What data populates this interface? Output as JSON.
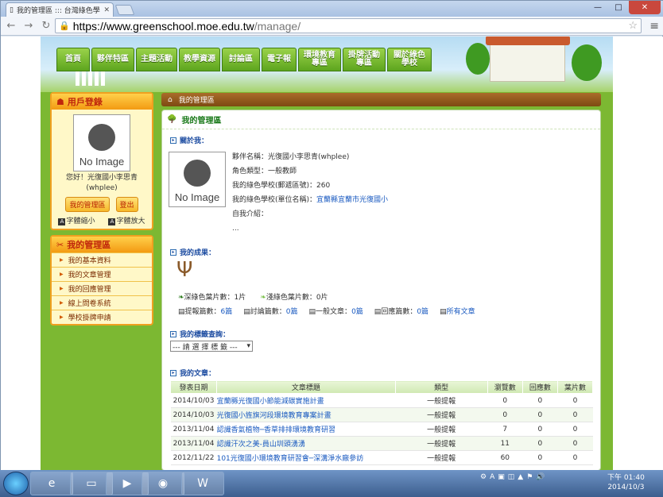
{
  "browser": {
    "tab_title": "我的管理區 ::: 台灣綠色學",
    "url_host": "https://www.greenschool.moe.edu.tw",
    "url_path": "/manage/"
  },
  "nav": {
    "items": [
      "首頁",
      "夥伴特區",
      "主題活動",
      "教學資源",
      "討論區",
      "電子報",
      "環境教育專區",
      "掛牌活動專區",
      "關於綠色學校"
    ]
  },
  "sidebar": {
    "login_title": "用戶登錄",
    "no_image": "No Image",
    "greeting": "您好！光復國小李思青",
    "user_id": "(whplee)",
    "btn_manage": "我的管理區",
    "btn_logout": "登出",
    "font_small": "字體縮小",
    "font_large": "字體放大",
    "menu_title": "我的管理區",
    "menu": [
      "我的基本資料",
      "我的文章管理",
      "我的回應管理",
      "線上問卷系統",
      "學校掛牌申請"
    ]
  },
  "breadcrumb": "我的管理區",
  "main": {
    "title": "我的管理區",
    "about_head": "關於我：",
    "no_image": "No Image",
    "fields": [
      {
        "k": "夥伴名稱：",
        "v": "光復國小李思青(whplee)"
      },
      {
        "k": "角色類型：",
        "v": "一般教師"
      },
      {
        "k": "我的綠色學校(郵遞區號)：",
        "v": "260"
      },
      {
        "k": "我的綠色學校(單位名稱)：",
        "v": "宜蘭縣宜蘭市光復國小"
      },
      {
        "k": "自我介紹：",
        "v": ""
      },
      {
        "k": "",
        "v": "..."
      }
    ],
    "results_head": "我的成果：",
    "deep_leaf": "深綠色葉片數：1片",
    "light_leaf": "淺綠色葉片數：0片",
    "stats": [
      {
        "k": "提報篇數：",
        "v": "6篇"
      },
      {
        "k": "討論篇數：",
        "v": "0篇"
      },
      {
        "k": "一般文章：",
        "v": "0篇"
      },
      {
        "k": "回應篇數：",
        "v": "0篇"
      }
    ],
    "all_articles": "所有文章",
    "tags_head": "我的標籤查詢：",
    "tag_select": "--- 請 選 擇 標 籤 ---",
    "articles_head": "我的文章：",
    "columns": [
      "發表日期",
      "文章標題",
      "類型",
      "瀏覽數",
      "回應數",
      "葉片數"
    ],
    "rows": [
      [
        "2014/10/03",
        "宜蘭縣光復國小節能減碳實施計畫",
        "一般提報",
        "0",
        "0",
        "0"
      ],
      [
        "2014/10/03",
        "光復國小旌旗河段環境教育專案計畫",
        "一般提報",
        "0",
        "0",
        "0"
      ],
      [
        "2013/11/04",
        "認識香氣植物─香草排排環境教育研習",
        "一般提報",
        "7",
        "0",
        "0"
      ],
      [
        "2013/11/04",
        "認識汗次之美-員山圳頭湧湧",
        "一般提報",
        "11",
        "0",
        "0"
      ],
      [
        "2012/11/22",
        "101光復國小環境教育研習會─深溝淨水廠參訪",
        "一般提報",
        "60",
        "0",
        "0"
      ]
    ]
  },
  "taskbar": {
    "time": "下午 01:40",
    "date": "2014/10/3"
  }
}
